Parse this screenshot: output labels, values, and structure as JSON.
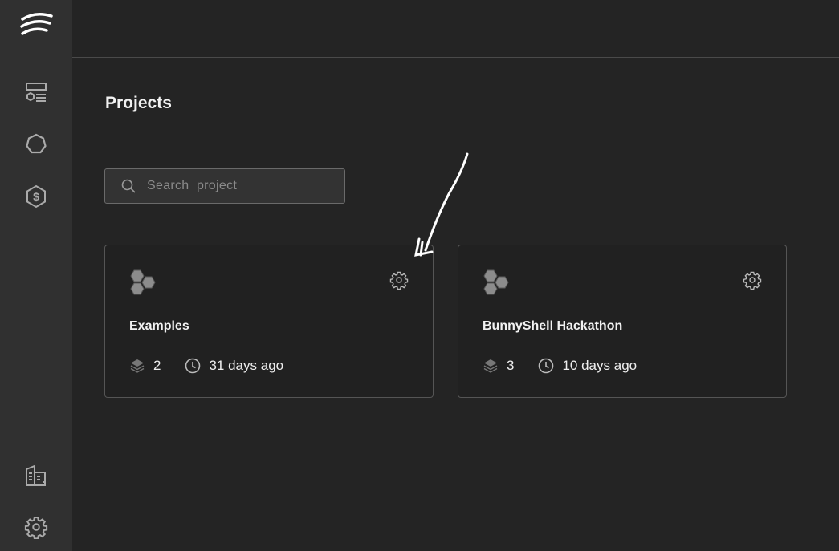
{
  "sidebar": {
    "items": [
      {
        "id": "logo",
        "icon": "wifi-logo-icon"
      },
      {
        "id": "dashboard",
        "icon": "layout-icon"
      },
      {
        "id": "components",
        "icon": "heptagon-icon"
      },
      {
        "id": "billing",
        "icon": "dollar-hex-icon"
      },
      {
        "id": "organization",
        "icon": "building-icon"
      },
      {
        "id": "settings",
        "icon": "gear-icon"
      }
    ]
  },
  "page": {
    "title": "Projects"
  },
  "search": {
    "placeholder": "Search  project"
  },
  "projects": [
    {
      "name": "Examples",
      "environments": "2",
      "updated": "31 days ago"
    },
    {
      "name": "BunnyShell Hackathon",
      "environments": "3",
      "updated": "10 days ago"
    }
  ]
}
